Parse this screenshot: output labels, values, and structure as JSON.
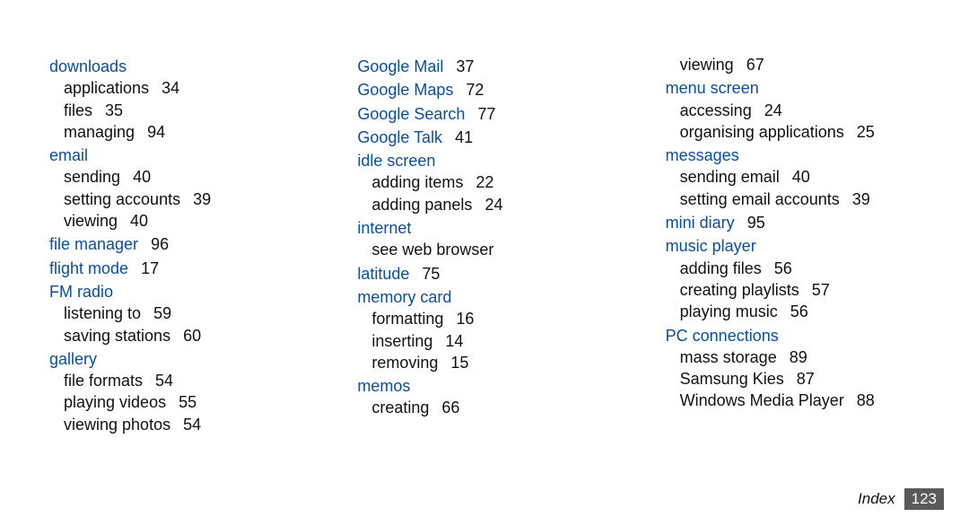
{
  "columns": [
    {
      "items": [
        {
          "type": "topic",
          "label": "downloads"
        },
        {
          "type": "sub",
          "label": "applications",
          "page": "34"
        },
        {
          "type": "sub",
          "label": "files",
          "page": "35"
        },
        {
          "type": "sub",
          "label": "managing",
          "page": "94"
        },
        {
          "type": "topic",
          "label": "email"
        },
        {
          "type": "sub",
          "label": "sending",
          "page": "40"
        },
        {
          "type": "sub",
          "label": "setting accounts",
          "page": "39"
        },
        {
          "type": "sub",
          "label": "viewing",
          "page": "40"
        },
        {
          "type": "topic",
          "label": "file manager",
          "page": "96"
        },
        {
          "type": "topic",
          "label": "flight mode",
          "page": "17"
        },
        {
          "type": "topic",
          "label": "FM radio"
        },
        {
          "type": "sub",
          "label": "listening to",
          "page": "59"
        },
        {
          "type": "sub",
          "label": "saving stations",
          "page": "60"
        },
        {
          "type": "topic",
          "label": "gallery"
        },
        {
          "type": "sub",
          "label": "file formats",
          "page": "54"
        },
        {
          "type": "sub",
          "label": "playing videos",
          "page": "55"
        },
        {
          "type": "sub",
          "label": "viewing photos",
          "page": "54"
        }
      ]
    },
    {
      "items": [
        {
          "type": "topic",
          "label": "Google Mail",
          "page": "37"
        },
        {
          "type": "topic",
          "label": "Google Maps",
          "page": "72"
        },
        {
          "type": "topic",
          "label": "Google Search",
          "page": "77"
        },
        {
          "type": "topic",
          "label": "Google Talk",
          "page": "41"
        },
        {
          "type": "topic",
          "label": "idle screen"
        },
        {
          "type": "sub",
          "label": "adding items",
          "page": "22"
        },
        {
          "type": "sub",
          "label": "adding panels",
          "page": "24"
        },
        {
          "type": "topic",
          "label": "internet"
        },
        {
          "type": "sub",
          "label": "see web browser"
        },
        {
          "type": "topic",
          "label": "latitude",
          "page": "75"
        },
        {
          "type": "topic",
          "label": "memory card"
        },
        {
          "type": "sub",
          "label": "formatting",
          "page": "16"
        },
        {
          "type": "sub",
          "label": "inserting",
          "page": "14"
        },
        {
          "type": "sub",
          "label": "removing",
          "page": "15"
        },
        {
          "type": "topic",
          "label": "memos"
        },
        {
          "type": "sub",
          "label": "creating",
          "page": "66"
        }
      ]
    },
    {
      "items": [
        {
          "type": "sub",
          "label": "viewing",
          "page": "67"
        },
        {
          "type": "topic",
          "label": "menu screen"
        },
        {
          "type": "sub",
          "label": "accessing",
          "page": "24"
        },
        {
          "type": "sub",
          "label": "organising applications",
          "page": "25"
        },
        {
          "type": "topic",
          "label": "messages"
        },
        {
          "type": "sub",
          "label": "sending email",
          "page": "40"
        },
        {
          "type": "sub",
          "label": "setting email accounts",
          "page": "39"
        },
        {
          "type": "topic",
          "label": "mini diary",
          "page": "95"
        },
        {
          "type": "topic",
          "label": "music player"
        },
        {
          "type": "sub",
          "label": "adding files",
          "page": "56"
        },
        {
          "type": "sub",
          "label": "creating playlists",
          "page": "57"
        },
        {
          "type": "sub",
          "label": "playing music",
          "page": "56"
        },
        {
          "type": "topic",
          "label": "PC connections"
        },
        {
          "type": "sub",
          "label": "mass storage",
          "page": "89"
        },
        {
          "type": "sub",
          "label": "Samsung Kies",
          "page": "87"
        },
        {
          "type": "sub",
          "label": "Windows Media Player",
          "page": "88"
        }
      ]
    }
  ],
  "footer": {
    "label": "Index",
    "page": "123"
  }
}
